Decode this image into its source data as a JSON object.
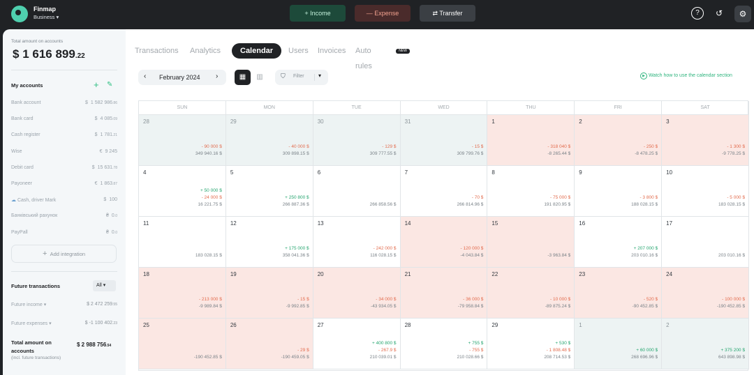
{
  "app": {
    "name": "Finmap",
    "workspace": "Business"
  },
  "topbar": {
    "income": "+ Income",
    "expense": "— Expense",
    "transfer": "⇄ Transfer"
  },
  "sidebar": {
    "total_label": "Total amount on accounts",
    "total_currency": "$",
    "total_value": "1 616 899",
    "total_cents": ".22",
    "my_accounts": "My accounts",
    "accounts": [
      {
        "name": "Bank account",
        "currency": "$",
        "amount": "1 582 986",
        "cents": ".86"
      },
      {
        "name": "Bank card",
        "currency": "$",
        "amount": "4 085",
        "cents": ".09"
      },
      {
        "name": "Cash register",
        "currency": "$",
        "amount": "1 781",
        "cents": ".21"
      },
      {
        "name": "Wise",
        "currency": "€",
        "amount": "9 245",
        "cents": ""
      },
      {
        "name": "Debit card",
        "currency": "$",
        "amount": "15 631",
        "cents": ".78"
      },
      {
        "name": "Payoneer",
        "currency": "€",
        "amount": "1 863",
        "cents": ".87"
      },
      {
        "name": "Cash, driver Mark",
        "currency": "$",
        "amount": "100",
        "cents": ""
      },
      {
        "name": "Банківський рахунок",
        "currency": "₴",
        "amount": "0",
        "cents": ".0"
      },
      {
        "name": "PayPall",
        "currency": "₴",
        "amount": "0",
        "cents": ".0"
      }
    ],
    "add_integration": "Add integration",
    "future_title": "Future transactions",
    "future_filter": "All",
    "future_income_label": "Future income",
    "future_income_value": "$ 2 472 259",
    "future_income_cents": ".55",
    "future_expenses_label": "Future expenses",
    "future_expenses_value": "$ -1 100 402",
    "future_expenses_cents": ".23",
    "future_total_label_1": "Total amount on",
    "future_total_label_2": "accounts",
    "future_total_value": "$ 2 988 756",
    "future_total_cents": ".54",
    "future_total_note": "(incl. future transactions)"
  },
  "tabs": [
    {
      "label": "Transactions"
    },
    {
      "label": "Analytics"
    },
    {
      "label": "Calendar"
    },
    {
      "label": "Users"
    },
    {
      "label": "Invoices"
    },
    {
      "label": "Auto rules"
    }
  ],
  "new_badge": "NEW",
  "calendar": {
    "month": "February 2024",
    "filter": "Filter",
    "help": "Watch how to use the calendar section",
    "days": [
      "SUN",
      "MON",
      "TUE",
      "WED",
      "THU",
      "FRI",
      "SAT"
    ]
  },
  "rows": [
    [
      {
        "day": "28",
        "state": "prev",
        "exp": "- 90 000  $",
        "bal": "349 940.16  $"
      },
      {
        "day": "29",
        "state": "prev",
        "exp": "- 40 000  $",
        "bal": "309 898.15  $"
      },
      {
        "day": "30",
        "state": "prev",
        "exp": "- 129  $",
        "bal": "309 777.55  $"
      },
      {
        "day": "31",
        "state": "prev",
        "exp": "- 15  $",
        "bal": "309 799.76  $"
      },
      {
        "day": "1",
        "state": "neg",
        "exp": "- 318 040  $",
        "bal": "-8 265.44  $"
      },
      {
        "day": "2",
        "state": "neg",
        "exp": "- 250  $",
        "bal": "-8 478.25  $"
      },
      {
        "day": "3",
        "state": "neg",
        "exp": "- 1 300  $",
        "bal": "-9 778.25  $"
      }
    ],
    [
      {
        "day": "4",
        "state": "",
        "inc": "+ 50 000  $",
        "exp": "- 24 000  $",
        "bal": "16 221.75  $"
      },
      {
        "day": "5",
        "state": "",
        "inc": "+ 250 800  $",
        "bal": "266 887.36  $"
      },
      {
        "day": "6",
        "state": "",
        "bal": "266 858.56  $"
      },
      {
        "day": "7",
        "state": "",
        "exp": "- 70  $",
        "bal": "266 814.96  $"
      },
      {
        "day": "8",
        "state": "",
        "exp": "- 75 000  $",
        "bal": "191 820.95  $"
      },
      {
        "day": "9",
        "state": "",
        "exp": "- 3 800  $",
        "bal": "188 028.15  $"
      },
      {
        "day": "10",
        "state": "",
        "exp": "- 5 000  $",
        "bal": "183 028.15  $"
      }
    ],
    [
      {
        "day": "11",
        "state": "",
        "bal": "183 028.15  $"
      },
      {
        "day": "12",
        "state": "",
        "inc": "+ 175 000  $",
        "bal": "358 041.36  $"
      },
      {
        "day": "13",
        "state": "",
        "exp": "- 242 000  $",
        "bal": "116 028.15  $"
      },
      {
        "day": "14",
        "state": "neg",
        "exp": "- 120 000  $",
        "bal": "-4 043.84  $"
      },
      {
        "day": "15",
        "state": "neg",
        "bal": "-3 963.84  $"
      },
      {
        "day": "16",
        "state": "",
        "inc": "+ 207 000  $",
        "bal": "203 010.16  $"
      },
      {
        "day": "17",
        "state": "",
        "bal": "203 010.16  $"
      }
    ],
    [
      {
        "day": "18",
        "state": "neg",
        "exp": "- 213 000  $",
        "bal": "-9 989.84  $"
      },
      {
        "day": "19",
        "state": "neg",
        "exp": "- 15  $",
        "bal": "-9 992.85  $"
      },
      {
        "day": "20",
        "state": "neg",
        "exp": "- 34 000  $",
        "bal": "-43 934.05  $"
      },
      {
        "day": "21",
        "state": "neg",
        "exp": "- 36 000  $",
        "bal": "-79 958.84  $"
      },
      {
        "day": "22",
        "state": "neg",
        "exp": "- 10 000  $",
        "bal": "-89 875.24  $"
      },
      {
        "day": "23",
        "state": "neg",
        "exp": "- 520  $",
        "bal": "-90 452.85  $"
      },
      {
        "day": "24",
        "state": "neg",
        "exp": "- 100 000  $",
        "bal": "-190 452.85  $"
      }
    ],
    [
      {
        "day": "25",
        "state": "neg",
        "bal": "-190 452.85  $"
      },
      {
        "day": "26",
        "state": "neg",
        "exp": "- 29  $",
        "bal": "-190 459.05  $"
      },
      {
        "day": "27",
        "state": "",
        "inc": "+ 400 800  $",
        "exp": "- 267.9  $",
        "bal": "210 039.01  $"
      },
      {
        "day": "28",
        "state": "",
        "inc": "+ 755  $",
        "exp": "- 755  $",
        "bal": "210 028.66  $"
      },
      {
        "day": "29",
        "state": "",
        "inc": "+ 530  $",
        "exp": "- 1 808.48  $",
        "bal": "208 714.53  $"
      },
      {
        "day": "1",
        "state": "prev",
        "inc": "+ 60 000  $",
        "bal": "268 696.96  $"
      },
      {
        "day": "2",
        "state": "prev",
        "inc": "+ 375 200  $",
        "bal": "643 898.98  $"
      }
    ]
  ]
}
